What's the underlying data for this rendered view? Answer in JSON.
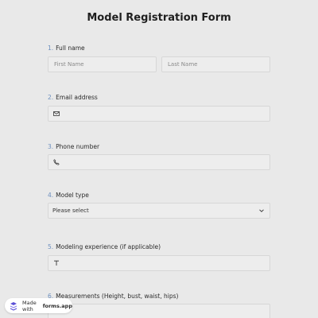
{
  "form": {
    "title": "Model Registration Form"
  },
  "questions": [
    {
      "num": "1.",
      "label": "Full name",
      "placeholders": [
        "First Name",
        "Last Name"
      ]
    },
    {
      "num": "2.",
      "label": "Email address",
      "icon": "mail-icon"
    },
    {
      "num": "3.",
      "label": "Phone number",
      "icon": "phone-icon"
    },
    {
      "num": "4.",
      "label": "Model type",
      "select_value": "Please select",
      "icon": "chevron-down-icon"
    },
    {
      "num": "5.",
      "label": "Modeling experience (if applicable)",
      "icon": "text-icon"
    },
    {
      "num": "6.",
      "label": "Measurements (Height, bust, waist, hips)"
    }
  ],
  "badge": {
    "prefix": "Made with",
    "brand": "forms.app",
    "icon": "forms-app-logo-icon"
  },
  "colors": {
    "background": "#e9e9e9",
    "field_bg": "#ededed",
    "number_accent": "#6c8fbf",
    "logo": "#5b4fd6"
  }
}
